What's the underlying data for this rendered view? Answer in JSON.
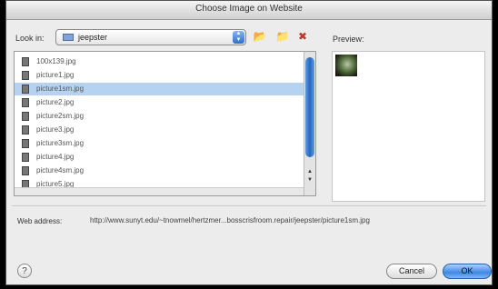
{
  "window": {
    "title": "Choose Image on Website"
  },
  "toolbar": {
    "look_in_label": "Look in:",
    "folder": "jeepster",
    "icons": [
      "up-folder-icon",
      "new-folder-icon",
      "delete-icon"
    ]
  },
  "files": [
    "100x139.jpg",
    "picture1.jpg",
    "picture1sm.jpg",
    "picture2.jpg",
    "picture2sm.jpg",
    "picture3.jpg",
    "picture3sm.jpg",
    "picture4.jpg",
    "picture4sm.jpg",
    "picture5.jpg"
  ],
  "selected_file": "picture1sm.jpg",
  "preview": {
    "label": "Preview:"
  },
  "web_address": {
    "label": "Web address:",
    "value": "http://www.sunyt.edu/~tnowmel/hertzmer...bosscrisfroom.repair/jeepster/picture1sm.jpg"
  },
  "buttons": {
    "help": "?",
    "cancel": "Cancel",
    "ok": "OK"
  }
}
